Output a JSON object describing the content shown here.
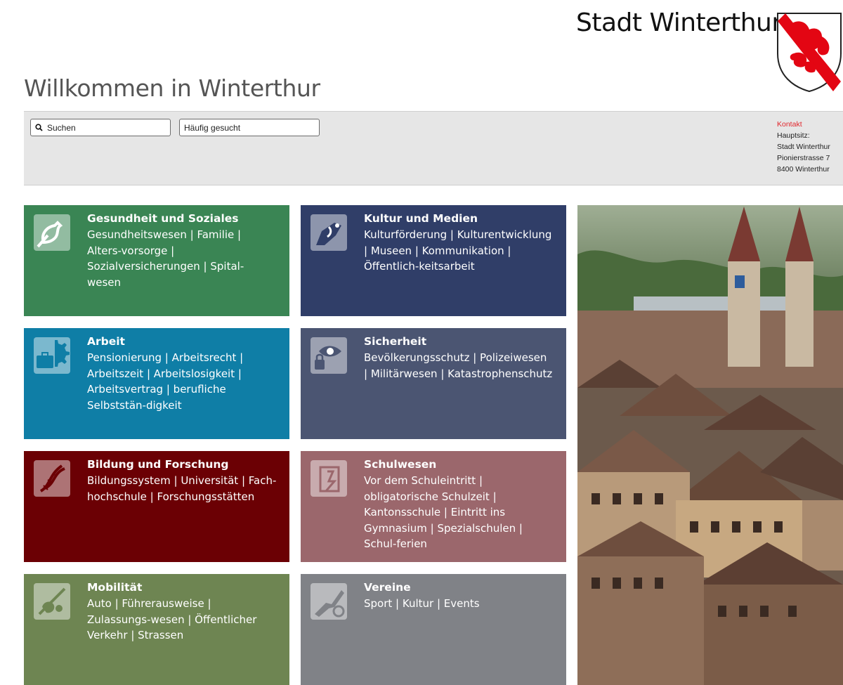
{
  "header": {
    "brand": "Stadt Winterthur",
    "welcome": "Willkommen in Winterthur"
  },
  "search": {
    "search_label": "Suchen",
    "frequent_label": "Häufig gesucht"
  },
  "contact": {
    "link": "Kontakt",
    "line1": "Hauptsitz:",
    "line2": "Stadt Winterthur",
    "line3": "Pionierstrasse 7",
    "line4": "8400 Winterthur"
  },
  "tiles": [
    {
      "title": "Gesundheit und Soziales",
      "links": "Gesundheitswesen | Familie | Alters-vorsorge | Sozialversicherungen | Spital-wesen",
      "color": "#3a8554",
      "icon": "health-icon"
    },
    {
      "title": "Kultur und Medien",
      "links": "Kulturförderung | Kulturentwicklung | Museen | Kommunikation | Öffentlich-keitsarbeit",
      "color": "#303e68",
      "icon": "culture-icon"
    },
    {
      "title": "Arbeit",
      "links": "Pensionierung | Arbeitsrecht | Arbeitszeit | Arbeitslosigkeit | Arbeitsvertrag | berufliche Selbststän-digkeit",
      "color": "#0f7ea6",
      "icon": "work-icon"
    },
    {
      "title": "Sicherheit",
      "links": "Bevölkerungsschutz | Polizeiwesen | Militärwesen | Katastrophenschutz",
      "color": "#4b5572",
      "icon": "security-icon"
    },
    {
      "title": "Bildung und Forschung",
      "links": "Bildungssystem | Universität | Fach-hochschule | Forschungsstätten",
      "color": "#6b0004",
      "icon": "education-icon"
    },
    {
      "title": "Schulwesen",
      "links": "Vor dem Schuleintritt | obligatorische Schulzeit | Kantonsschule | Eintritt ins Gymnasium | Spezialschulen | Schul-ferien",
      "color": "#9b676c",
      "icon": "school-icon"
    },
    {
      "title": "Mobilität",
      "links": "Auto | Führerausweise | Zulassungs-wesen | Öffentlicher Verkehr | Strassen",
      "color": "#6e8552",
      "icon": "mobility-icon"
    },
    {
      "title": "Vereine",
      "links": "Sport | Kultur | Events",
      "color": "#808287",
      "icon": "clubs-icon"
    }
  ]
}
